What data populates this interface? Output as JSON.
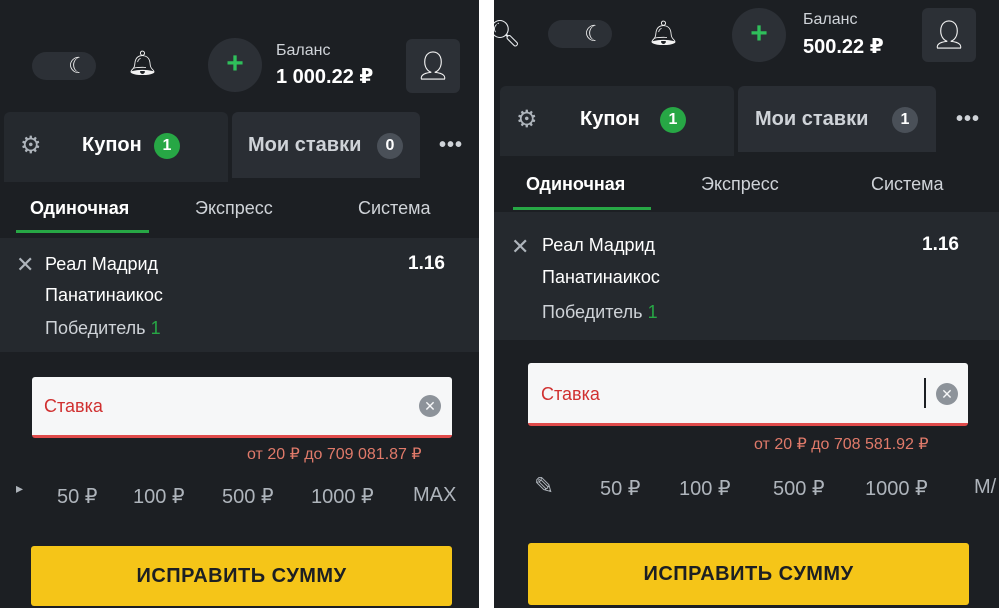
{
  "left": {
    "balance_label": "Баланс",
    "balance_value": "1 000.22 ₽",
    "tabs": [
      {
        "label": "Купон",
        "count": "1"
      },
      {
        "label": "Мои ставки",
        "count": "0"
      }
    ],
    "bet_types": [
      "Одиночная",
      "Экспресс",
      "Система"
    ],
    "bet": {
      "team1": "Реал Мадрид",
      "team2": "Панатинаикос",
      "odds": "1.16",
      "market_prefix": "Победитель",
      "market_selection": "1"
    },
    "stake_placeholder": "Ставка",
    "range_text": "от 20 ₽ до 709 081.87 ₽",
    "quick_amounts": [
      "50 ₽",
      "100 ₽",
      "500 ₽",
      "1000 ₽",
      "MAX"
    ],
    "fix_button": "ИСПРАВИТЬ СУММУ"
  },
  "right": {
    "balance_label": "Баланс",
    "balance_value": "500.22 ₽",
    "tabs": [
      {
        "label": "Купон",
        "count": "1"
      },
      {
        "label": "Мои ставки",
        "count": "1"
      }
    ],
    "bet_types": [
      "Одиночная",
      "Экспресс",
      "Система"
    ],
    "bet": {
      "team1": "Реал Мадрид",
      "team2": "Панатинаикос",
      "odds": "1.16",
      "market_prefix": "Победитель",
      "market_selection": "1"
    },
    "stake_placeholder": "Ставка",
    "range_text": "от 20 ₽ до 708 581.92 ₽",
    "quick_amounts": [
      "50 ₽",
      "100 ₽",
      "500 ₽",
      "1000 ₽",
      "M/"
    ],
    "fix_button": "ИСПРАВИТЬ СУММУ"
  },
  "icons": {
    "theme": "moon-icon",
    "notifications": "bell-icon",
    "deposit": "plus-icon",
    "profile": "user-icon",
    "settings": "gear-icon",
    "more": "more-dots-icon",
    "remove": "close-icon",
    "clear": "clear-icon",
    "edit": "pencil-icon",
    "search": "search-icon"
  },
  "colors": {
    "background": "#1c1f23",
    "accent_green": "#27a745",
    "warning_yellow": "#f5c518",
    "error_red": "#e04b4b"
  }
}
